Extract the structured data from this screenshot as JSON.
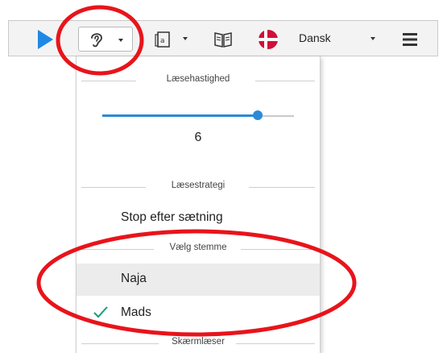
{
  "toolbar": {
    "play_icon": "play-icon",
    "ear_icon": "ear-icon",
    "book_icon": "book-page-icon",
    "open_book_icon": "open-book-icon",
    "flag_icon": "danish-flag-icon",
    "language": "Dansk",
    "menu_icon": "hamburger-menu-icon",
    "accent_color": "#1e88e5",
    "flag_color": "#d0103a"
  },
  "panel": {
    "speed_header": "Læsehastighed",
    "speed_value": "6",
    "speed_level_fraction": 0.81,
    "strategy_header": "Læsestrategi",
    "strategy_value": "Stop efter sætning",
    "voice_header": "Vælg stemme",
    "voices": [
      {
        "label": "Naja",
        "selected": false,
        "highlighted": true
      },
      {
        "label": "Mads",
        "selected": true,
        "highlighted": false
      }
    ],
    "screenreader_header": "Skærmlæser"
  },
  "annotation_color": "#e8141b"
}
